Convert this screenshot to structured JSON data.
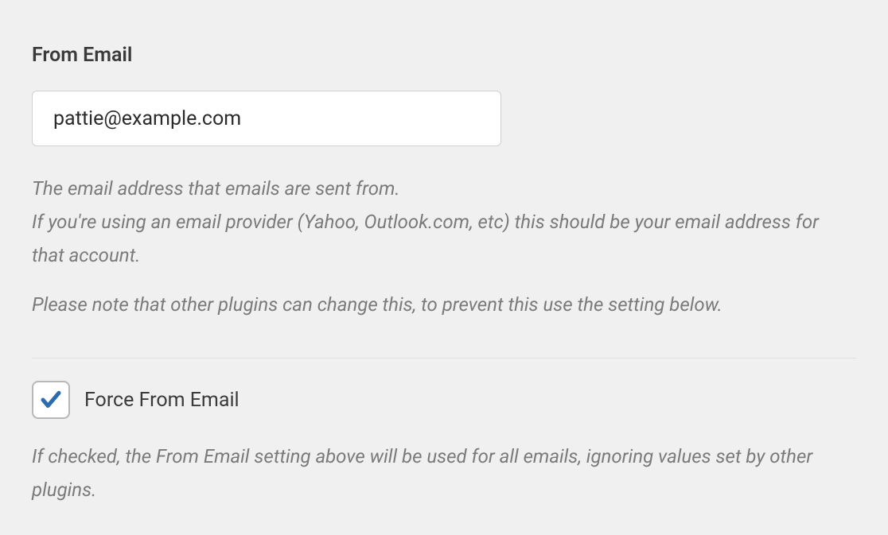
{
  "from_email": {
    "label": "From Email",
    "value": "pattie@example.com",
    "help_line_1": "The email address that emails are sent from.",
    "help_line_2": "If you're using an email provider (Yahoo, Outlook.com, etc) this should be your email address for that account.",
    "help_note": "Please note that other plugins can change this, to prevent this use the setting below."
  },
  "force_from_email": {
    "label": "Force From Email",
    "checked": true,
    "help_text": "If checked, the From Email setting above will be used for all emails, ignoring values set by other plugins."
  }
}
